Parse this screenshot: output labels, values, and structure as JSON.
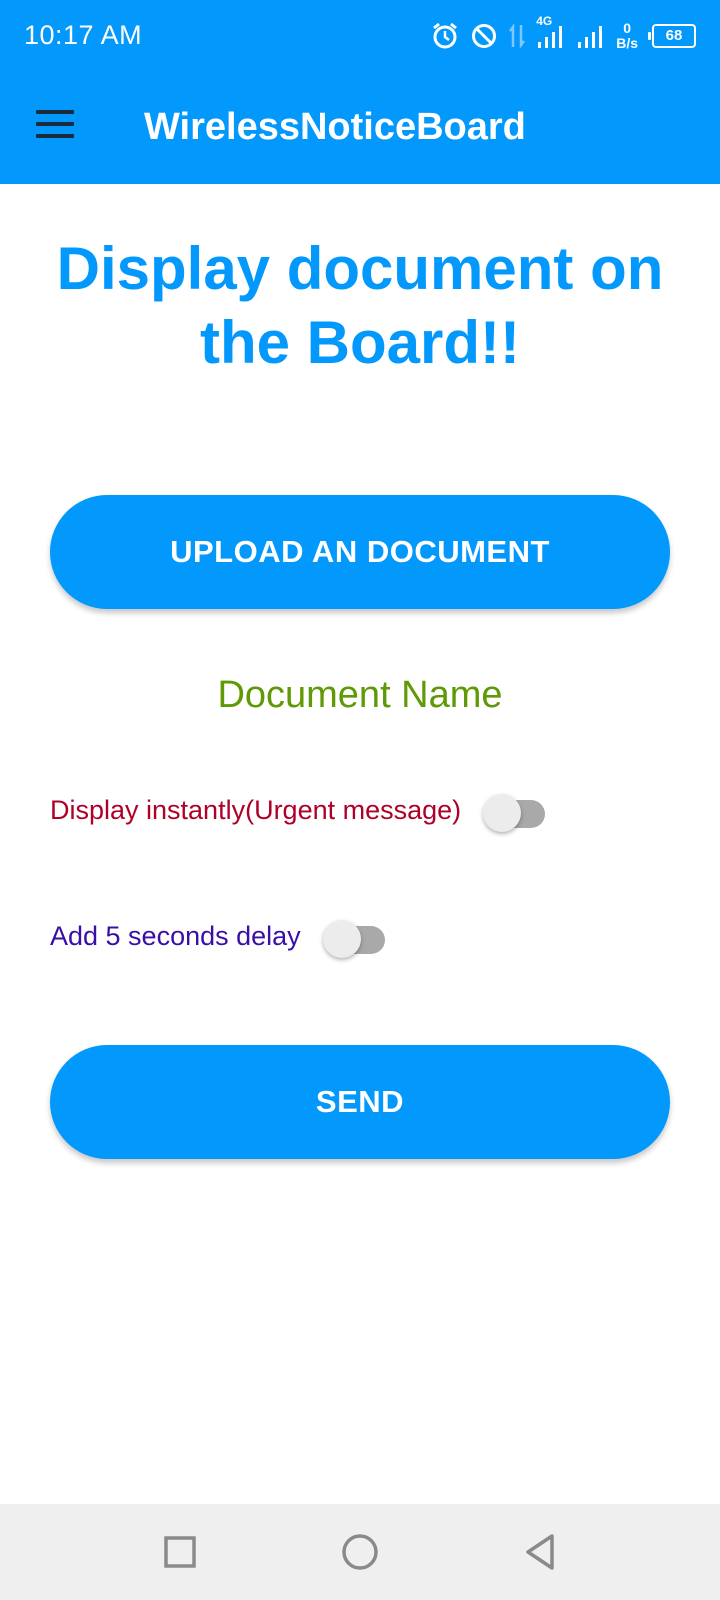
{
  "status_bar": {
    "time": "10:17 AM",
    "network_type": "4G",
    "net_speed_value": "0",
    "net_speed_unit": "B/s",
    "battery_level": "68"
  },
  "app_bar": {
    "title": "WirelessNoticeBoard",
    "menu_icon": "hamburger-menu-icon"
  },
  "main": {
    "heading": "Display document on the Board!!",
    "upload_button_label": "UPLOAD AN DOCUMENT",
    "document_name": "Document Name",
    "urgent_switch": {
      "label": "Display instantly(Urgent message)",
      "checked": false
    },
    "delay_switch": {
      "label": "Add 5 seconds delay",
      "checked": false
    },
    "send_button_label": "SEND"
  },
  "nav_bar": {
    "icons": [
      "recents-square-icon",
      "home-circle-icon",
      "back-triangle-icon"
    ]
  },
  "colors": {
    "primary": "#0398fc",
    "document_name": "#5f9a06",
    "urgent_label": "#b00028",
    "delay_label": "#3a0fa8"
  }
}
